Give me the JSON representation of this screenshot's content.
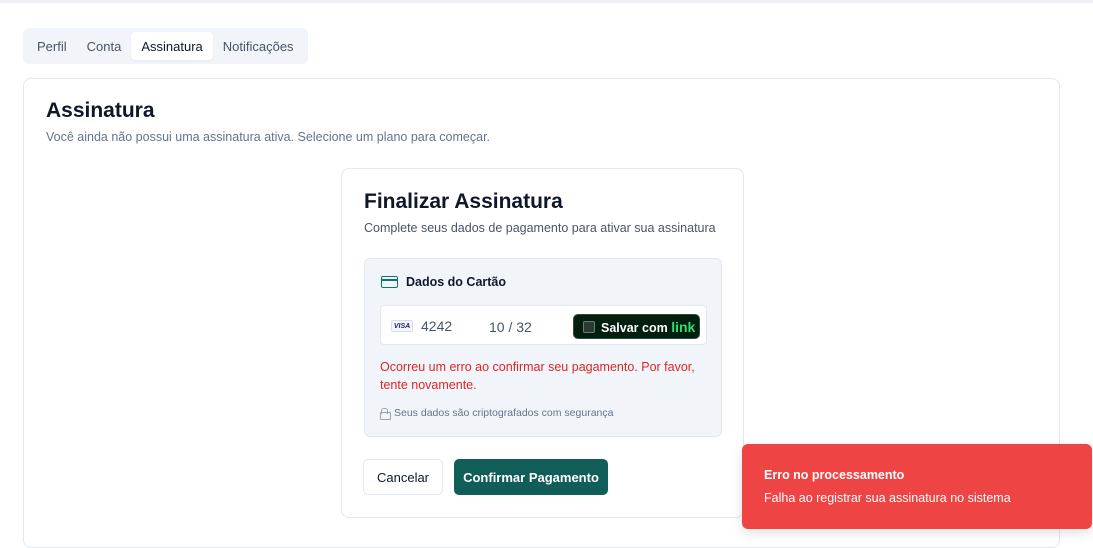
{
  "tabs": [
    {
      "label": "Perfil",
      "active": false
    },
    {
      "label": "Conta",
      "active": false
    },
    {
      "label": "Assinatura",
      "active": true
    },
    {
      "label": "Notificações",
      "active": false
    }
  ],
  "section": {
    "title": "Assinatura",
    "subtitle": "Você ainda não possui uma assinatura ativa. Selecione um plano para começar."
  },
  "checkout": {
    "title": "Finalizar Assinatura",
    "subtitle": "Complete seus dados de pagamento para ativar sua assinatura",
    "card_section_title": "Dados do Cartão",
    "card_brand": "VISA",
    "card_last4": "4242",
    "card_expiry": "10 / 32",
    "save_with_label": "Salvar com",
    "save_with_brand": "link",
    "error_message": "Ocorreu um erro ao confirmar seu pagamento. Por favor, tente novamente.",
    "security_note": "Seus dados são criptografados com segurança",
    "cancel_label": "Cancelar",
    "confirm_label": "Confirmar Pagamento"
  },
  "toast": {
    "title": "Erro no processamento",
    "description": "Falha ao registrar sua assinatura no sistema"
  },
  "colors": {
    "primary": "#115e59",
    "error": "#dc2626",
    "toast_bg": "#ef4444",
    "link_bg": "#011e0f",
    "link_accent": "#33dd6e"
  }
}
